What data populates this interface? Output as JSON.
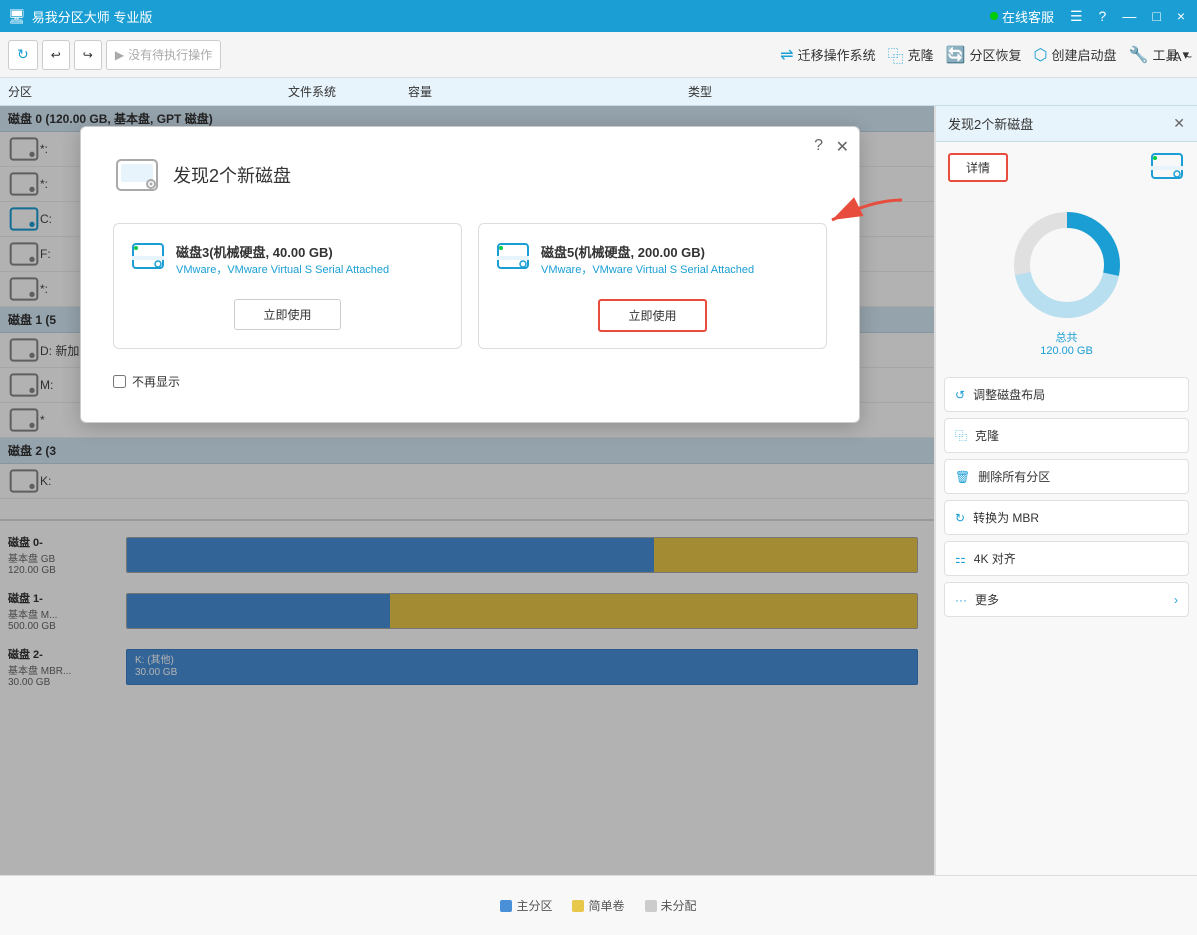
{
  "app": {
    "title": "易我分区大师 专业版",
    "title_icon": "🖥"
  },
  "titlebar": {
    "minimize": "—",
    "maximize": "□",
    "close": "×"
  },
  "toolbar": {
    "refresh_label": "c",
    "undo_label": "↩",
    "redo_label": "↪",
    "pending_label": "没有待执行操作",
    "migrate_label": "迁移操作系统",
    "clone_label": "克隆",
    "restore_label": "分区恢复",
    "create_boot_label": "创建启动盘",
    "tools_label": "工具"
  },
  "table_header": {
    "col1": "分区",
    "col2": "文件系统",
    "col3": "容量",
    "col4": "类型"
  },
  "disk0": {
    "header": "磁盘 0 (120.00 GB, 基本盘, GPT 磁盘)",
    "partitions": [
      {
        "name": "*:",
        "fs": "",
        "size": "",
        "type": ""
      },
      {
        "name": "*:",
        "fs": "",
        "size": "",
        "type": ""
      },
      {
        "name": "C:",
        "fs": "",
        "size": "",
        "type": ""
      },
      {
        "name": "F:",
        "fs": "",
        "size": "",
        "type": ""
      },
      {
        "name": "*:",
        "fs": "",
        "size": "",
        "type": ""
      }
    ]
  },
  "disk1": {
    "header": "磁盘 1 (5",
    "partitions": [
      {
        "name": "D: 新加",
        "fs": "",
        "size": "",
        "type": ""
      },
      {
        "name": "M:",
        "fs": "",
        "size": "",
        "type": ""
      },
      {
        "name": "*",
        "fs": "",
        "size": "",
        "type": ""
      }
    ],
    "info1": "基本盘 M",
    "info2": "500.00 GB"
  },
  "disk_0_bottom": {
    "label": "磁盘 0-",
    "info1": "基本盘 GB",
    "info2": "120.00 GB"
  },
  "disk_1_bottom": {
    "label": "磁盘 1-",
    "info1": "基本盘 MBR...",
    "info2": "500.00 GB"
  },
  "disk_2_bottom": {
    "label": "磁盘 2-",
    "info1": "基本盘 MBR...",
    "info2": "30.00 GB",
    "bar_label": "K: (其他)",
    "bar_size": "30.00 GB"
  },
  "disk2": {
    "header": "磁盘 2 (3",
    "partitions": [
      {
        "name": "K:",
        "fs": "",
        "size": "",
        "type": ""
      }
    ]
  },
  "right_panel": {
    "header": "发现2个新磁盘",
    "close_label": "×",
    "detail_label": "详情",
    "total_label": "总共",
    "total_size": "120.00 GB",
    "actions": [
      {
        "icon": "↺",
        "label": "调整磁盘布局"
      },
      {
        "icon": "📋",
        "label": "克隆"
      },
      {
        "icon": "🗑",
        "label": "删除所有分区"
      },
      {
        "icon": "↻",
        "label": "转换为 MBR"
      },
      {
        "icon": "⚏",
        "label": "4K 对齐"
      },
      {
        "icon": "···",
        "label": "更多",
        "arrow": true
      }
    ]
  },
  "modal": {
    "title": "发现2个新磁盘",
    "disk3": {
      "name": "磁盘3(机械硬盘, 40.00 GB)",
      "sub": "VMware，VMware Virtual S Serial Attached",
      "btn": "立即使用"
    },
    "disk5": {
      "name": "磁盘5(机械硬盘, 200.00 GB)",
      "sub": "VMware，VMware Virtual S Serial Attached",
      "btn": "立即使用"
    },
    "checkbox_label": "不再显示"
  },
  "bottom_legend": {
    "items": [
      {
        "color": "#4a90d9",
        "label": "主分区"
      },
      {
        "color": "#e8c84a",
        "label": "简单卷"
      },
      {
        "color": "#cccccc",
        "label": "未分配"
      }
    ]
  },
  "online_service": "在线客服",
  "ia_label": "IA ~"
}
